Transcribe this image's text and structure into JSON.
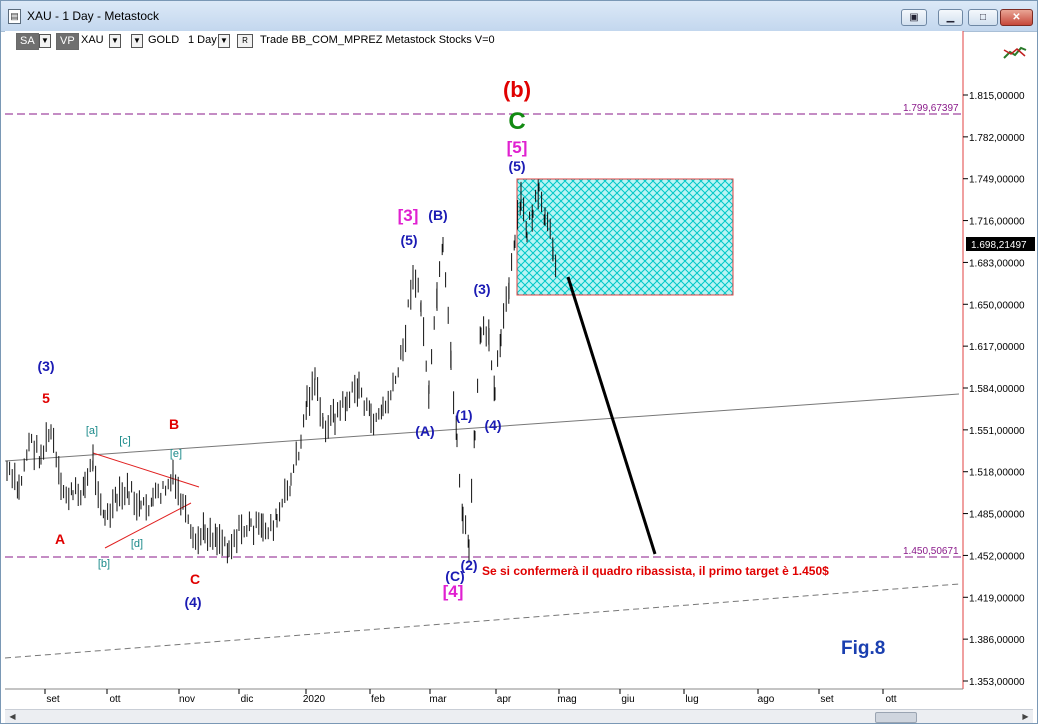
{
  "window": {
    "title": "XAU - 1 Day - Metastock"
  },
  "toolbar": {
    "sa": "SA",
    "vp": "VP",
    "symbol": "XAU",
    "name": "GOLD",
    "period": "1 Day",
    "r": "R",
    "rest": "Trade  BB_COM_MPREZ  Metastock  Stocks  V=0"
  },
  "price_axis": {
    "ticks": [
      "1.815,00000",
      "1.782,00000",
      "1.749,00000",
      "1.716,00000",
      "1.683,00000",
      "1.650,00000",
      "1.617,00000",
      "1.584,00000",
      "1.551,00000",
      "1.518,00000",
      "1.485,00000",
      "1.452,00000",
      "1.419,00000",
      "1.386,00000",
      "1.353,00000"
    ],
    "current_price": "1.698,21497"
  },
  "levels": {
    "upper": "1.799,67397",
    "lower": "1.450,50671"
  },
  "time_axis": {
    "months": [
      "set",
      "ott",
      "nov",
      "dic",
      "2020",
      "feb",
      "mar",
      "apr",
      "mag",
      "giu",
      "lug",
      "ago",
      "set",
      "ott"
    ]
  },
  "annotations": {
    "b_big": "(b)",
    "c_green": "C",
    "five_bracket": "[5]",
    "five_paren": "(5)",
    "three_bracket": "[3]",
    "B_paren": "(B)",
    "five_paren_b": "(5)",
    "three_paren": "(3)",
    "one_paren": "(1)",
    "four_paren": "(4)",
    "A_paren": "(A)",
    "two_paren": "(2)",
    "C_paren": "(C)",
    "four_bracket": "[4]",
    "three_left": "(3)",
    "five_red": "5",
    "a_teal": "[a]",
    "c_teal": "[c]",
    "B_red": "B",
    "e_teal": "[e]",
    "A_red": "A",
    "b_teal": "[b]",
    "d_teal": "[d]",
    "C_red": "C",
    "four_left": "(4)"
  },
  "note": "Se si confermerà il quadro ribassista, il primo target è 1.450$",
  "figure_label": "Fig.8",
  "colors": {
    "red": "#e00000",
    "blue": "#1b1bb4",
    "magenta": "#e020d0",
    "green": "#128a12",
    "teal": "#1b8a8a",
    "purple_dash": "#8a1a8a",
    "box": "#00d0d0"
  }
}
